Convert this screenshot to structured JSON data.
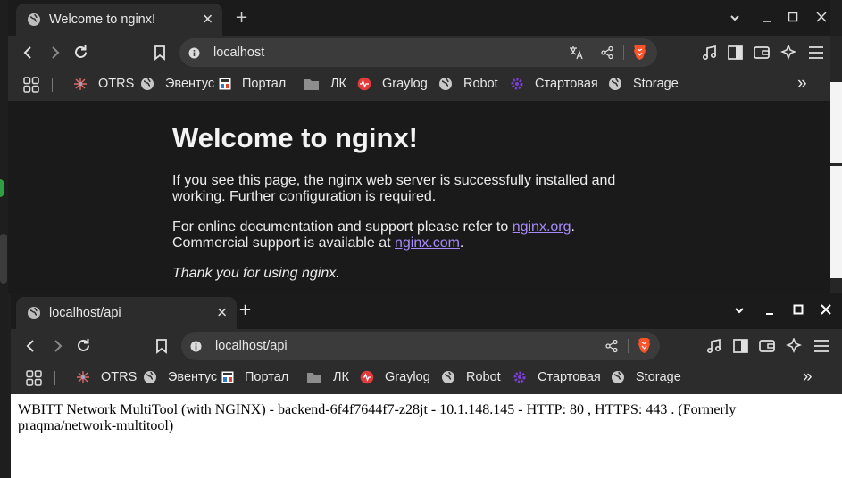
{
  "back_window": {
    "tab": {
      "title": "Welcome to nginx!",
      "close": "✕"
    },
    "new_tab": "+",
    "url": "localhost",
    "page": {
      "heading": "Welcome to nginx!",
      "p1": "If you see this page, the nginx web server is successfully installed and working. Further configuration is required.",
      "p2_text": "For online documentation and support please refer to ",
      "p2_link": "nginx.org",
      "p2_after": ".",
      "p3_text": "Commercial support is available at ",
      "p3_link": "nginx.com",
      "p3_after": ".",
      "thanks": "Thank you for using nginx."
    }
  },
  "front_window": {
    "tab": {
      "title": "localhost/api",
      "close": "✕"
    },
    "new_tab": "+",
    "url": "localhost/api",
    "page": {
      "body": "WBITT Network MultiTool (with NGINX) - backend-6f4f7644f7-z28jt - 10.1.148.145 - HTTP: 80 , HTTPS: 443 . (Formerly praqma/network-multitool)"
    }
  },
  "bookmarks": [
    {
      "label": "OTRS",
      "icon": "otrs-icon"
    },
    {
      "label": "Эвентус",
      "icon": "globe-icon"
    },
    {
      "label": "Портал",
      "icon": "portal-icon"
    },
    {
      "label": "ЛК",
      "icon": "folder-icon"
    },
    {
      "label": "Graylog",
      "icon": "graylog-icon"
    },
    {
      "label": "Robot",
      "icon": "globe-icon"
    },
    {
      "label": "Стартовая",
      "icon": "gear-icon"
    },
    {
      "label": "Storage",
      "icon": "globe-icon"
    }
  ],
  "overflow": "»",
  "colors": {
    "link": "#a78bfa",
    "brave": "#fb542b",
    "chrome_dark": "#2c2c2c"
  }
}
